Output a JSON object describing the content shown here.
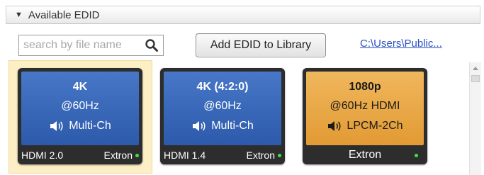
{
  "panel": {
    "collapse_glyph": "▼",
    "title": "Available EDID"
  },
  "toolbar": {
    "search_placeholder": "search by file name",
    "add_button_label": "Add EDID to Library",
    "path_link": "C:\\Users\\Public..."
  },
  "tiles": [
    {
      "resolution": "4K",
      "rate": "@60Hz",
      "audio": "Multi-Ch",
      "hdmi": "HDMI 2.0",
      "brand": "Extron",
      "selected": true,
      "color": "#3a69bb"
    },
    {
      "resolution": "4K (4:2:0)",
      "rate": "@60Hz",
      "audio": "Multi-Ch",
      "hdmi": "HDMI 1.4",
      "brand": "Extron",
      "selected": false,
      "color": "#3a69bb"
    },
    {
      "resolution": "1080p",
      "rate": "@60Hz  HDMI",
      "audio": "LPCM-2Ch",
      "brand": "Extron",
      "selected": false,
      "color": "#e8a845"
    }
  ],
  "colors": {
    "tile_blue": "#3a69bb",
    "tile_orange": "#e8a845",
    "tile_frame": "#2d2d2d",
    "selection_highlight": "#fcefc6",
    "status_led": "#3fe043",
    "link": "#2b53c2"
  },
  "icons": {
    "search": "search-icon",
    "speaker": "speaker-icon",
    "collapse": "collapse-triangle-icon"
  }
}
